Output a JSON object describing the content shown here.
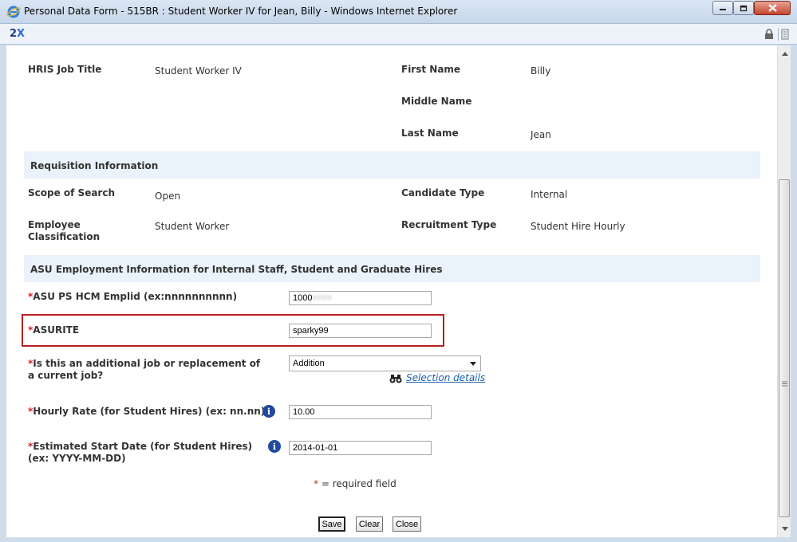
{
  "window": {
    "title": "Personal Data Form - 515BR : Student Worker IV for Jean, Billy - Windows Internet Explorer",
    "toolbar_logo_a": "2",
    "toolbar_logo_b": "X"
  },
  "job_info": {
    "hris_job_title_label": "HRIS Job Title",
    "hris_job_title_value": "Student Worker IV",
    "first_name_label": "First Name",
    "first_name_value": "Billy",
    "middle_name_label": "Middle Name",
    "middle_name_value": "",
    "last_name_label": "Last Name",
    "last_name_value": "Jean"
  },
  "requisition": {
    "heading": "Requisition Information",
    "scope_label": "Scope of Search",
    "scope_value": "Open",
    "candidate_type_label": "Candidate Type",
    "candidate_type_value": "Internal",
    "employee_class_label_1": "Employee",
    "employee_class_label_2": "Classification",
    "employee_class_value": "Student Worker",
    "recruitment_type_label": "Recruitment Type",
    "recruitment_type_value": "Student Hire Hourly"
  },
  "employment": {
    "heading": "ASU Employment Information for Internal Staff, Student and Graduate Hires",
    "required_mark": "*",
    "emplid_label": "ASU PS HCM Emplid (ex:nnnnnnnnnn)",
    "emplid_value_visible": "1000",
    "emplid_value_masked": "####",
    "asurite_label": "ASURITE",
    "asurite_value": "sparky99",
    "job_type_label_1": "Is this an additional job or replacement of",
    "job_type_label_2": "a current job?",
    "job_type_selected": "Addition",
    "selection_details_link": "Selection details",
    "hourly_rate_label": "Hourly Rate (for Student Hires) (ex: nn.nn)",
    "hourly_rate_value": "10.00",
    "start_date_label_1": "Estimated Start Date (for Student Hires)",
    "start_date_label_2": "(ex: YYYY-MM-DD)",
    "start_date_value": "2014-01-01",
    "info_glyph": "i",
    "required_note": "= required field"
  },
  "buttons": {
    "save": "Save",
    "clear": "Clear",
    "close": "Close"
  },
  "icons": [
    "ie-logo-icon",
    "minimize-icon",
    "maximize-icon",
    "close-icon",
    "lock-icon",
    "info-icon",
    "binoculars-icon",
    "scroll-up-icon",
    "scroll-down-icon"
  ],
  "colors": {
    "required": "#c8282d",
    "section_bg": "#eaf2fb",
    "highlight_border": "#b81f1f",
    "link": "#1a5fb4"
  }
}
